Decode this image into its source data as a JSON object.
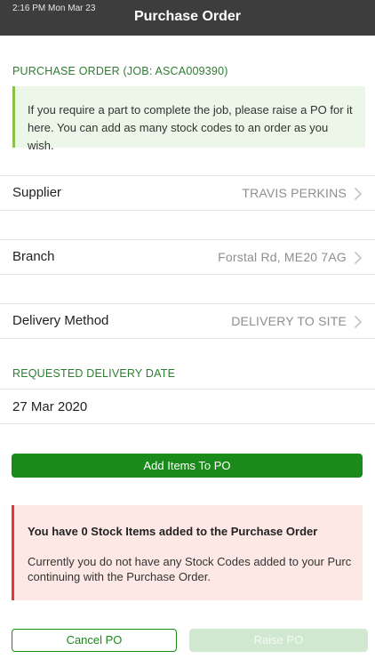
{
  "status_bar": {
    "time": "2:16 PM   Mon Mar 23"
  },
  "nav": {
    "title": "Purchase Order"
  },
  "po_section": {
    "header": "PURCHASE ORDER (JOB: ASCA009390)",
    "info_line1": "If you require a part to complete the job, please raise a PO for it",
    "info_line2": "here. You can add as many stock codes to an order as you wish."
  },
  "supplier": {
    "label": "Supplier",
    "value": "TRAVIS PERKINS"
  },
  "branch": {
    "label": "Branch",
    "value": "Forstal Rd, ME20 7AG"
  },
  "delivery_method": {
    "label": "Delivery Method",
    "value": "DELIVERY TO SITE"
  },
  "delivery_date": {
    "header": "REQUESTED DELIVERY DATE",
    "value": "27 Mar 2020"
  },
  "add_items_label": "Add Items To PO",
  "warning": {
    "title": "You have 0 Stock Items added to the Purchase Order",
    "line1": "Currently you do not have any Stock Codes added to your Purc",
    "line2": "continuing with the Purchase Order."
  },
  "footer": {
    "cancel_label": "Cancel PO",
    "raise_label": "Raise PO"
  },
  "colors": {
    "accent_green": "#1a8a1a",
    "header_green": "#2e7d32",
    "info_border": "#8bc34a",
    "warning_border": "#e53935"
  }
}
